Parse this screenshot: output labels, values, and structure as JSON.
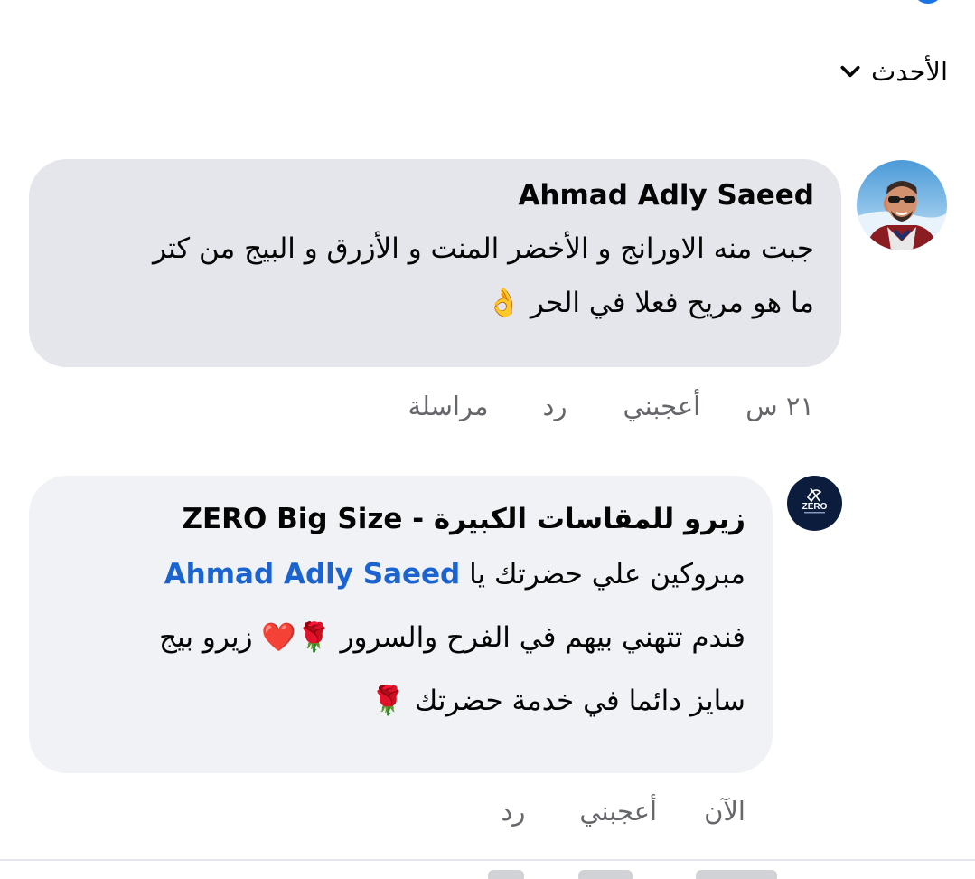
{
  "sort": {
    "label": "الأحدث"
  },
  "comments": [
    {
      "author": "Ahmad Adly Saeed",
      "lines": [
        "جبت منه الاورانج و الأخضر المنت و الأزرق و البيج من كتر",
        "ما هو مريح فعلا في الحر 👌"
      ],
      "time": "٢١ س",
      "like_label": "أعجبني",
      "reply_label": "رد",
      "message_label": "مراسلة"
    },
    {
      "author": "زيرو للمقاسات الكبيرة - ZERO Big Size",
      "line1_prefix": "مبروكين علي حضرتك يا ",
      "mention": "Ahmad Adly Saeed",
      "line2": "فندم تتهني بيهم في الفرح والسرور 🌹❤️ زيرو بيج",
      "line3": "سايز دائما في خدمة حضرتك 🌹",
      "time": "الآن",
      "like_label": "أعجبني",
      "reply_label": "رد"
    }
  ],
  "page_logo": {
    "text": "ZERO"
  }
}
